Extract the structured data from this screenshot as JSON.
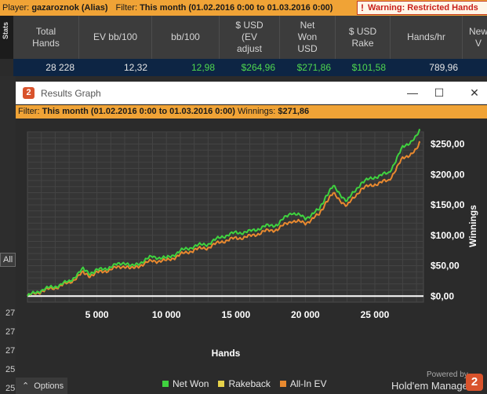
{
  "topbar": {
    "player_label": "Player:",
    "player_value": "gazaroznok (Alias)",
    "filter_label": "Filter:",
    "filter_value": "This month (01.02.2016 0:00 to 01.03.2016 0:00)",
    "warning": "Warning: Restricted Hands",
    "warning_icon": "exclamation-icon"
  },
  "stats_tab": "Stats",
  "columns": [
    "Total\nHands",
    "EV bb/100",
    "bb/100",
    "$ USD\n(EV\nadjust",
    "Net\nWon\nUSD",
    "$ USD\nRake",
    "Hands/hr",
    "New\nV"
  ],
  "row": [
    "28 228",
    "12,32",
    "12,98",
    "$264,96",
    "$271,86",
    "$101,58",
    "789,96",
    ""
  ],
  "left": {
    "all_input": "All",
    "row_numbers": [
      "27",
      "27",
      "27",
      "25",
      "25"
    ],
    "options_label": "Options"
  },
  "window": {
    "app_icon": "2",
    "title": "Results Graph",
    "filter_label": "Filter:",
    "filter_value": "This month (01.02.2016 0:00 to 01.03.2016 0:00)",
    "winnings_label": "Winnings:",
    "winnings_value": "$271,86",
    "powered_by": "Powered by",
    "brand": "Hold'em Manager",
    "brand_badge": "2"
  },
  "colors": {
    "net_won": "#3fd23f",
    "rakeback": "#e6d24a",
    "all_in_ev": "#e8892f",
    "accent": "#f0a336",
    "brand": "#d9532c"
  },
  "chart_data": {
    "type": "line",
    "xlabel": "Hands",
    "ylabel": "Winnings",
    "xlim": [
      0,
      28500
    ],
    "ylim": [
      -10,
      270
    ],
    "x_ticks": [
      5000,
      10000,
      15000,
      20000,
      25000
    ],
    "x_tick_labels": [
      "5 000",
      "10 000",
      "15 000",
      "20 000",
      "25 000"
    ],
    "y_ticks": [
      0,
      50,
      100,
      150,
      200,
      250
    ],
    "y_tick_labels": [
      "$0,00",
      "$50,00",
      "$100,00",
      "$150,00",
      "$200,00",
      "$250,00"
    ],
    "grid": true,
    "legend_position": "bottom",
    "series": [
      {
        "name": "Net Won",
        "color": "#3fd23f",
        "points": [
          [
            0,
            0
          ],
          [
            1000,
            10
          ],
          [
            2000,
            16
          ],
          [
            3000,
            24
          ],
          [
            4000,
            44
          ],
          [
            4500,
            38
          ],
          [
            5000,
            42
          ],
          [
            6000,
            48
          ],
          [
            7000,
            56
          ],
          [
            7500,
            48
          ],
          [
            8000,
            54
          ],
          [
            9000,
            65
          ],
          [
            10000,
            62
          ],
          [
            11000,
            74
          ],
          [
            12000,
            82
          ],
          [
            13000,
            86
          ],
          [
            14000,
            98
          ],
          [
            15000,
            104
          ],
          [
            16000,
            106
          ],
          [
            17000,
            114
          ],
          [
            18000,
            118
          ],
          [
            19000,
            138
          ],
          [
            20000,
            128
          ],
          [
            21000,
            142
          ],
          [
            21500,
            166
          ],
          [
            22000,
            180
          ],
          [
            23000,
            156
          ],
          [
            24000,
            186
          ],
          [
            25000,
            196
          ],
          [
            26000,
            202
          ],
          [
            27000,
            244
          ],
          [
            28000,
            262
          ],
          [
            28228,
            272
          ]
        ]
      },
      {
        "name": "Rakeback",
        "color": "#e6d24a",
        "points": []
      },
      {
        "name": "All-In EV",
        "color": "#e8892f",
        "points": [
          [
            0,
            0
          ],
          [
            1000,
            8
          ],
          [
            2000,
            14
          ],
          [
            3000,
            22
          ],
          [
            4000,
            38
          ],
          [
            4500,
            34
          ],
          [
            5000,
            38
          ],
          [
            6000,
            44
          ],
          [
            7000,
            50
          ],
          [
            7500,
            44
          ],
          [
            8000,
            50
          ],
          [
            9000,
            58
          ],
          [
            10000,
            58
          ],
          [
            11000,
            68
          ],
          [
            12000,
            76
          ],
          [
            13000,
            80
          ],
          [
            14000,
            90
          ],
          [
            15000,
            95
          ],
          [
            16000,
            98
          ],
          [
            17000,
            106
          ],
          [
            18000,
            110
          ],
          [
            19000,
            124
          ],
          [
            20000,
            120
          ],
          [
            21000,
            134
          ],
          [
            21500,
            156
          ],
          [
            22000,
            168
          ],
          [
            23000,
            148
          ],
          [
            24000,
            176
          ],
          [
            25000,
            184
          ],
          [
            26000,
            190
          ],
          [
            27000,
            226
          ],
          [
            28000,
            240
          ],
          [
            28228,
            252
          ]
        ]
      }
    ]
  }
}
